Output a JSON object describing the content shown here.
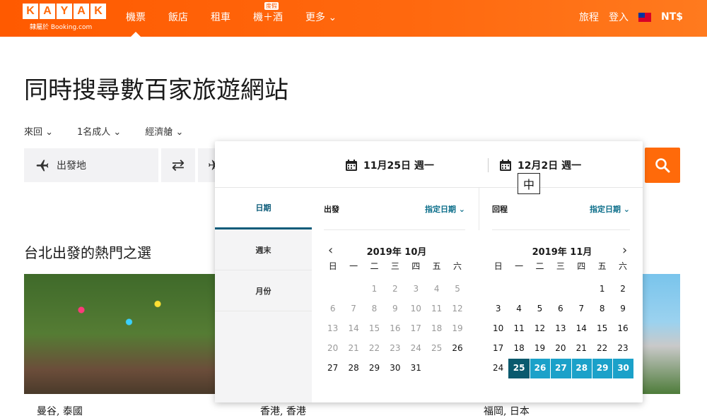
{
  "header": {
    "logo_letters": [
      "K",
      "A",
      "Y",
      "A",
      "K"
    ],
    "logo_sub": "隸屬於 Booking.com",
    "nav": [
      {
        "label": "機票",
        "active": true
      },
      {
        "label": "飯店"
      },
      {
        "label": "租車"
      },
      {
        "label": "機＋酒",
        "badge": "度假"
      },
      {
        "label": "更多 ⌄"
      }
    ],
    "right": {
      "trips": "旅程",
      "login": "登入",
      "currency": "NT$"
    }
  },
  "headline": "同時搜尋數百家旅遊網站",
  "options": [
    "來回 ⌄",
    "1名成人 ⌄",
    "經濟艙 ⌄"
  ],
  "search": {
    "origin_placeholder": "出發地",
    "swap_icon": "⇄"
  },
  "section_title": "台北出發的熱門之選",
  "cards": [
    {
      "label": "曼谷, 泰國"
    },
    {
      "label": "香港, 香港"
    },
    {
      "label": "福岡, 日本"
    }
  ],
  "popup": {
    "depart_date": "11月25日 週一",
    "return_date": "12月2日 週一",
    "ime": "中",
    "sidebar": [
      "日期",
      "週末",
      "月份"
    ],
    "depart_label": "出發",
    "return_label": "回程",
    "flex_label": "指定日期 ⌄",
    "weekdays": [
      "日",
      "一",
      "二",
      "三",
      "四",
      "五",
      "六"
    ],
    "month1": {
      "title": "2019年 10月",
      "days": [
        [
          "",
          "",
          "1",
          "2",
          "3",
          "4",
          "5"
        ],
        [
          "6",
          "7",
          "8",
          "9",
          "10",
          "11",
          "12"
        ],
        [
          "13",
          "14",
          "15",
          "16",
          "17",
          "18",
          "19"
        ],
        [
          "20",
          "21",
          "22",
          "23",
          "24",
          "25",
          "26"
        ],
        [
          "27",
          "28",
          "29",
          "30",
          "31",
          "",
          ""
        ]
      ]
    },
    "month2": {
      "title": "2019年 11月",
      "days": [
        [
          "",
          "",
          "",
          "",
          "",
          "1",
          "2"
        ],
        [
          "3",
          "4",
          "5",
          "6",
          "7",
          "8",
          "9"
        ],
        [
          "10",
          "11",
          "12",
          "13",
          "14",
          "15",
          "16"
        ],
        [
          "17",
          "18",
          "19",
          "20",
          "21",
          "22",
          "23"
        ],
        [
          "24",
          "25",
          "26",
          "27",
          "28",
          "29",
          "30"
        ]
      ]
    },
    "selected_start": "25",
    "selected_range": [
      "26",
      "27",
      "28",
      "29",
      "30"
    ]
  }
}
